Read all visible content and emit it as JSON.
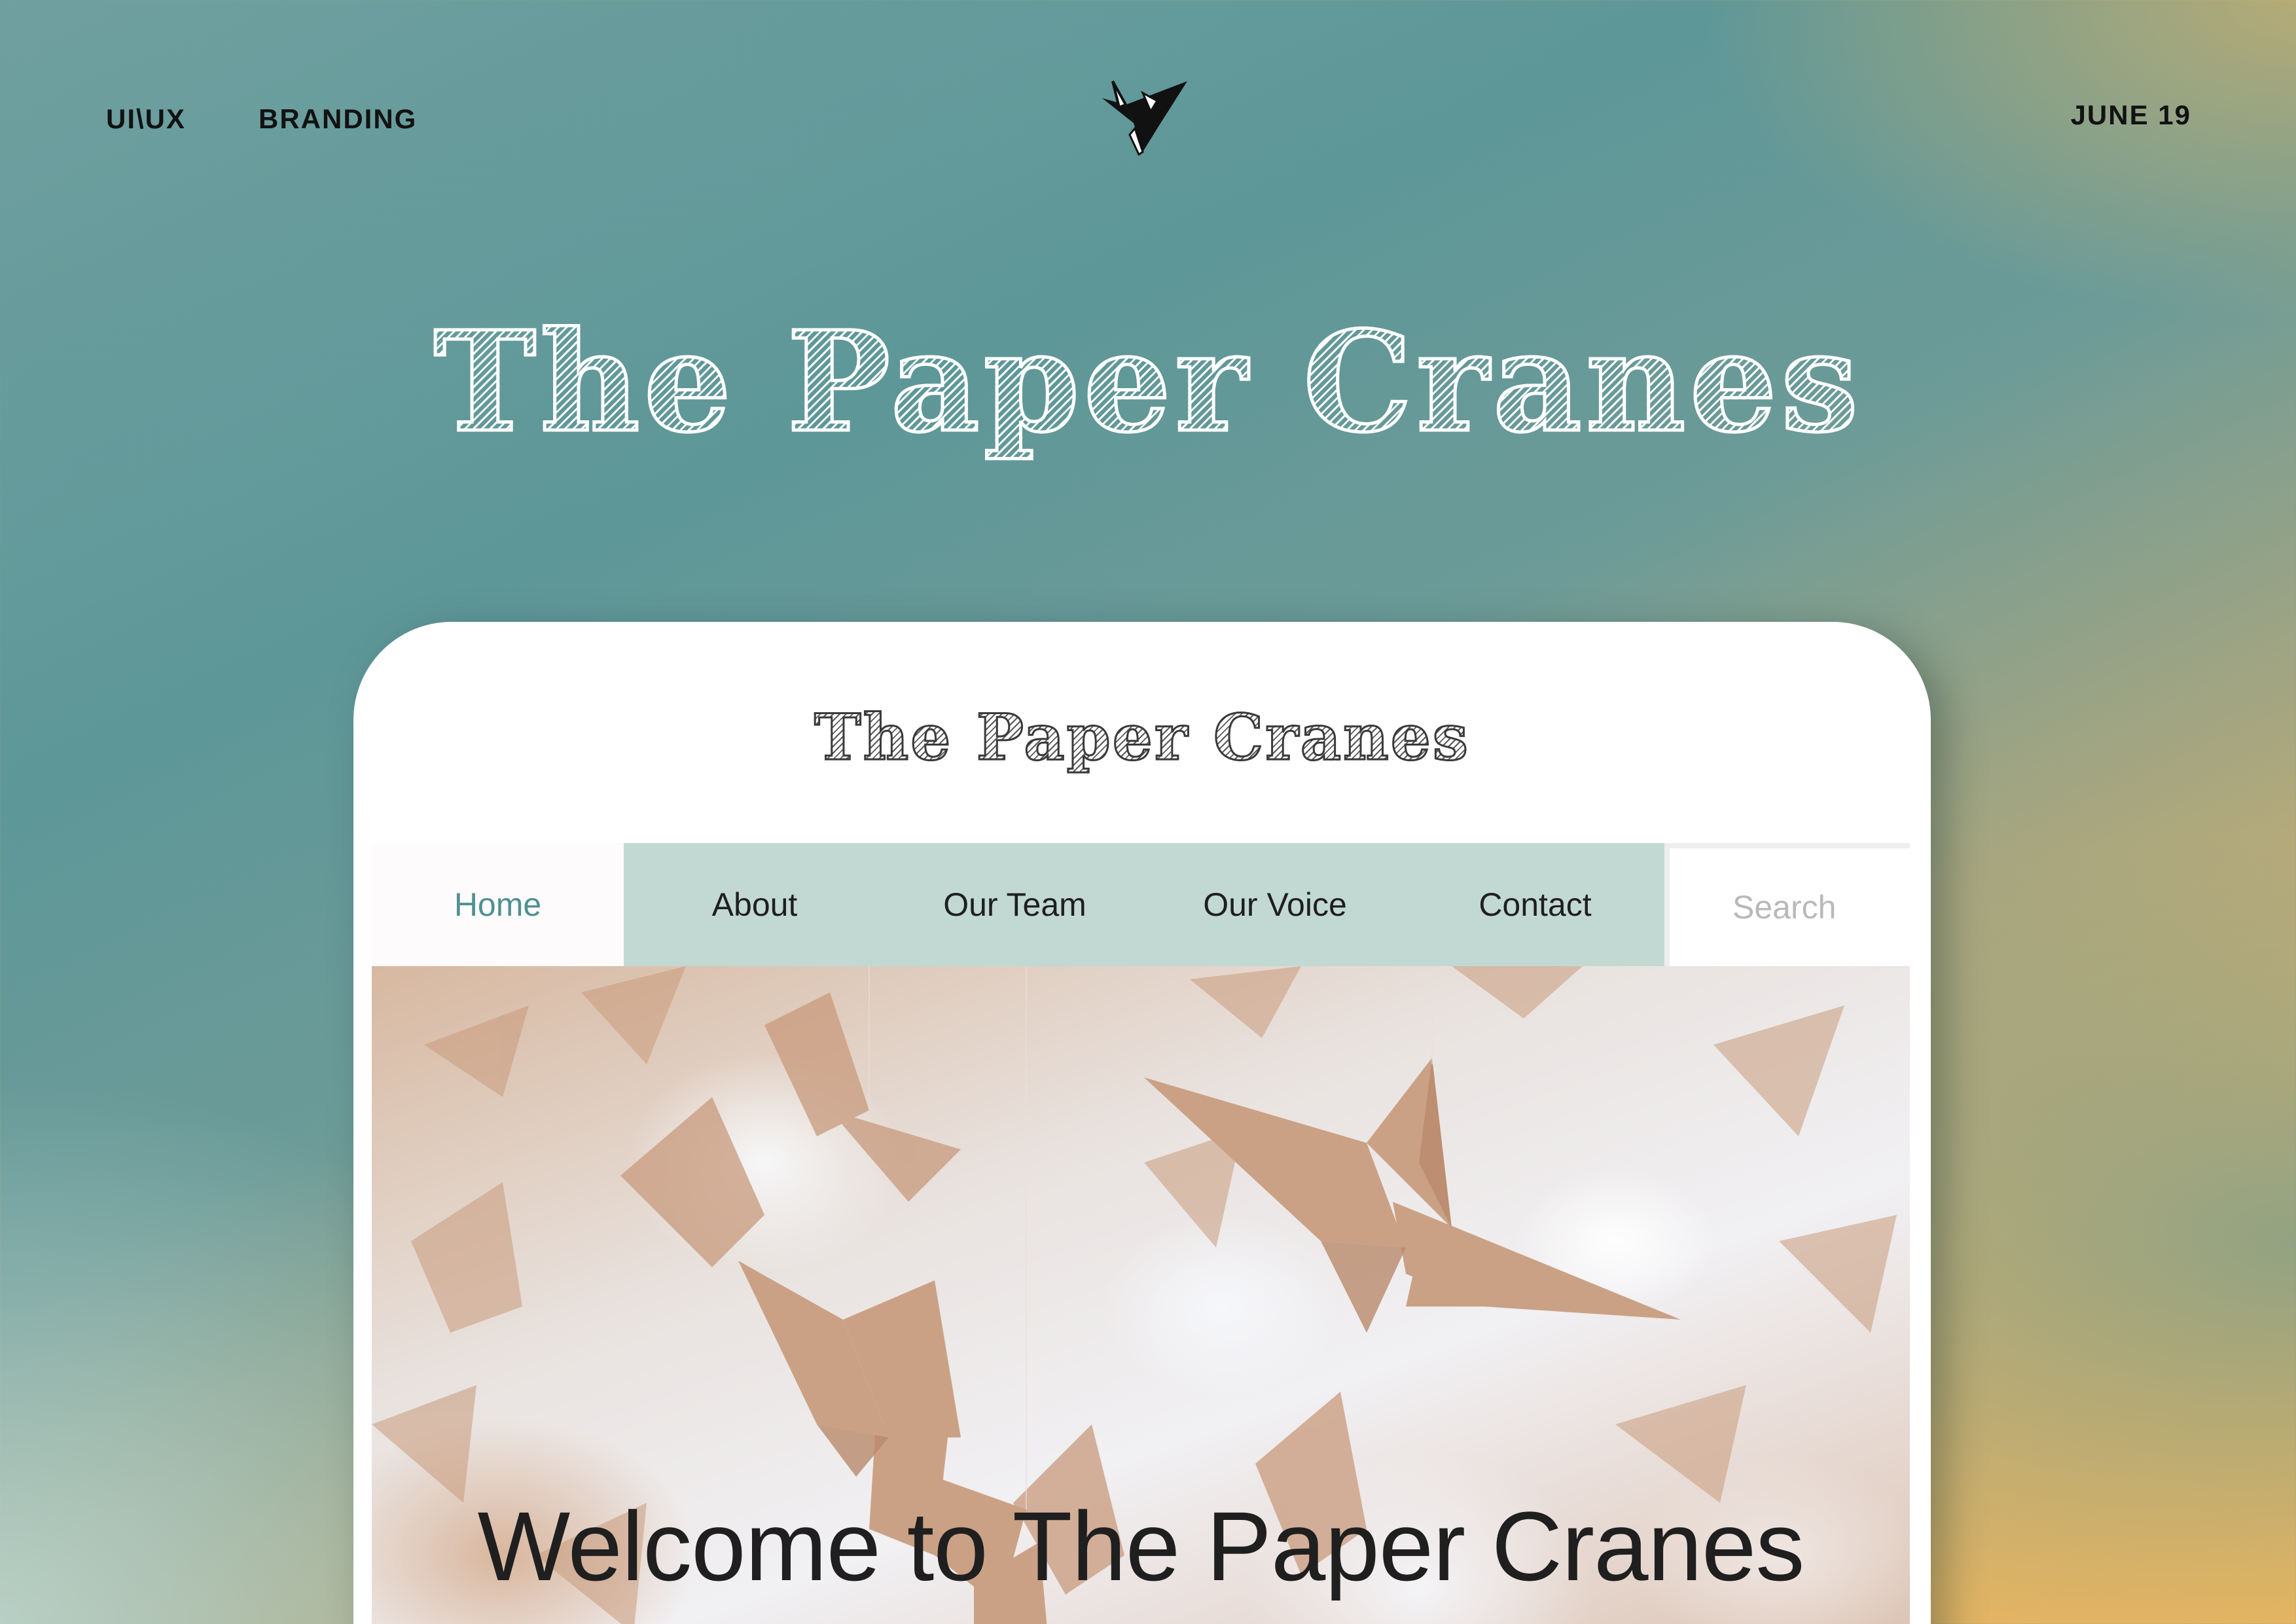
{
  "topbar": {
    "links": [
      "UI\\UX",
      "BRANDING"
    ],
    "date": "JUNE 19"
  },
  "hero": {
    "title": "The Paper Cranes"
  },
  "site": {
    "title": "The Paper Cranes",
    "nav": {
      "home": "Home",
      "about": "About",
      "team": "Our Team",
      "voice": "Our Voice",
      "contact": "Contact"
    },
    "search": {
      "placeholder": "Search"
    },
    "welcome": "Welcome to The Paper Cranes"
  },
  "colors": {
    "nav_bar": "#c2d9d3",
    "nav_active_text": "#4f9190",
    "crane_paper": "#c89a7c"
  },
  "icons": {
    "logo": "origami-crane-icon"
  }
}
